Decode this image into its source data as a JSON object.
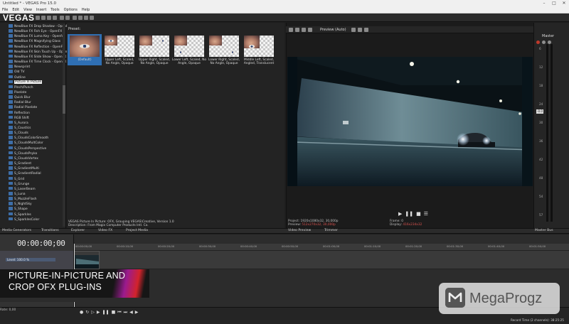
{
  "window": {
    "title": "Untitled * - VEGAS Pro 15.0"
  },
  "menu": {
    "items": [
      "File",
      "Edit",
      "View",
      "Insert",
      "Tools",
      "Options",
      "Help"
    ]
  },
  "logo": "VEGAS",
  "fx_list": {
    "items": [
      "NewBlue FX Drop Shadow - OpenFX",
      "NewBlue FX Fish Eye - OpenFX",
      "NewBlue FX Luma Key - Openfx",
      "NewBlue FX Magnifying Glass",
      "NewBlue FX Reflection - OpenFX",
      "NewBlue FX Skin Touch Up - OpenFX",
      "NewBlue FX Slide Show - OpenFX",
      "NewBlue FX Time Clock - OpenFX",
      "Newsprint",
      "Old TV",
      "Outline",
      "Picture In Picture",
      "Pinch/Punch",
      "Pixelate",
      "Quick Blur",
      "Radial Blur",
      "Radial Pixelate",
      "Reflection",
      "RGB Shift",
      "S_Aurora",
      "S_Caustics",
      "S_Clouds",
      "S_CloudsColorSmooth",
      "S_CloudsMultColor",
      "S_CloudsPerspective",
      "S_CloudsPsyko",
      "S_CloudsVortex",
      "S_Gradient",
      "S_GradientMulti",
      "S_GradientRadial",
      "S_Grid",
      "S_Grunge",
      "S_LaserBeam",
      "S_Luna",
      "S_MuzzleFlash",
      "S_NightSky",
      "S_Shape",
      "S_Sparkles",
      "S_SparklesColor"
    ],
    "selected_index": 11
  },
  "presets": {
    "label": "Preset:",
    "items": [
      "(Default)",
      "Upper Left, Scaled, No Angle, Opaque",
      "Upper Right, Scaled, No Angle, Opaque",
      "Lower Left, Scaled, No Angle, Opaque",
      "Lower Right, Scaled, No Angle, Opaque",
      "Middle Left, Scaled, Angled, Translucent"
    ],
    "description_line1": "VEGAS Picture In Picture: OFX, Grouping VEGAS\\Creative, Version 1.0",
    "description_line2": "Description: From Magix Computer Products Intl. Co."
  },
  "preview": {
    "mode": "Preview (Auto)",
    "project_label": "Project:",
    "project_value": "1920x1080x32, 30,000p",
    "preview_label": "Preview:",
    "preview_value": "512x270x32, 30,000p",
    "frame_label": "Frame:",
    "frame_value": "0",
    "display_label": "Display:",
    "display_value": "416x234x32"
  },
  "master": {
    "label": "Master",
    "level": "-0.0",
    "scale": [
      "6",
      "12",
      "18",
      "24",
      "30",
      "36",
      "42",
      "48",
      "54",
      "57"
    ]
  },
  "tabs": {
    "media_generators": "Media Generators",
    "transitions": "Transitions",
    "explorer": "Explorer",
    "video_fx": "Video FX",
    "project_media": "Project Media",
    "video_preview": "Video Preview",
    "trimmer": "Trimmer",
    "master_bus": "Master Bus"
  },
  "timeline": {
    "timecode": "00:00:00;00",
    "level_label": "Level: 100.0 %",
    "ruler": [
      "00:00:00;00",
      "00:00:10;00",
      "00:00:20;00",
      "00:00:30;00",
      "00:00:40;00",
      "00:00:50;00",
      "00:01:00;00",
      "00:01:10;00",
      "00:01:20;00",
      "00:01:30;00",
      "00:01:40;00",
      "00:01:50;00"
    ]
  },
  "banner": {
    "line1": "PICTURE-IN-PICTURE AND",
    "line2": "CROP OFX PLUG-INS"
  },
  "bottom": {
    "rate": "Rate: 0,00",
    "record_time": "Record Time (2 channels): 38:25:25"
  },
  "watermark": "MegaProgz",
  "colors": {
    "selection": "#2f6fb3",
    "banner_accent_1": "#9a1b8f",
    "banner_accent_2": "#d3232b"
  }
}
